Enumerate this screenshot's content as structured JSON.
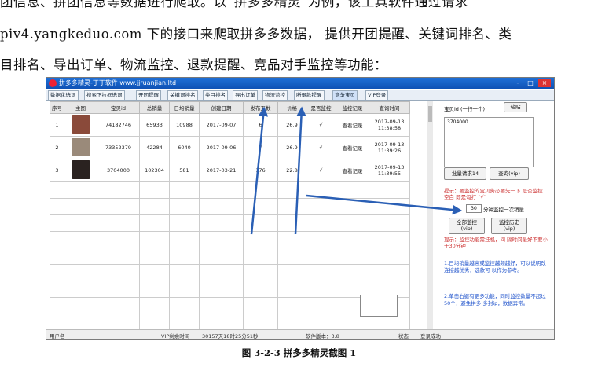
{
  "paragraph": {
    "line1": "团信息、拼团信息等数据进行爬取。以“拼多多精灵”为例，该工具软件通过请求",
    "line2": "piv4.yangkeduo.com 下的接口来爬取拼多多数据， 提供开团提醒、关键词排名、类",
    "line3": "目排名、导出订单、物流监控、退款提醒、竞品对手监控等功能："
  },
  "app": {
    "title": "拼多多精灵-丁丁软件 www.jjruanjian.ltd",
    "window_buttons": [
      "-",
      "□",
      "×"
    ],
    "tabs": [
      "数据化选词",
      "搜索下拉框选词",
      "开团提醒",
      "关键词排名",
      "类目排名",
      "导出订单",
      "物流监控",
      "断退款提醒",
      "竞争宝贝",
      "VIP登录"
    ],
    "columns": [
      "序号",
      "主图",
      "宝贝id",
      "总销量",
      "日均销量",
      "创建日期",
      "发布天数",
      "价格",
      "是否监控",
      "监控记录",
      "查询时间"
    ],
    "rows": [
      {
        "index": "1",
        "id": "74182746",
        "total": "65933",
        "daily": "10988",
        "created": "2017-09-07",
        "days": "6",
        "price": "26.9",
        "monitored": "√",
        "record": "查看记录",
        "time_date": "2017-09-13",
        "time_clock": "11:38:58",
        "thumb_color": "#8a4a3a"
      },
      {
        "index": "2",
        "id": "73352379",
        "total": "42284",
        "daily": "6040",
        "created": "2017-09-06",
        "days": "7",
        "price": "26.9",
        "monitored": "√",
        "record": "查看记录",
        "time_date": "2017-09-13",
        "time_clock": "11:39:26",
        "thumb_color": "#9a8a7a"
      },
      {
        "index": "3",
        "id": "3704000",
        "total": "102304",
        "daily": "581",
        "created": "2017-03-21",
        "days": "176",
        "price": "22.8",
        "monitored": "√",
        "record": "查看记录",
        "time_date": "2017-09-13",
        "time_clock": "11:39:55",
        "thumb_color": "#2a2220"
      }
    ],
    "right_panel": {
      "header": "宝贝id (一行一个)",
      "paste_button": "粘贴",
      "id_list": "3704000",
      "import_button": "批量请求14",
      "query_button": "查询(vip)",
      "hint": "提示：要监控的宝贝务必要先一下 是否监控 空白 即是勾打 “√”",
      "interval_value": "30",
      "interval_label": "分钟监控一次销量",
      "start_button": "全部监控",
      "start_button_sub": "(vip)",
      "history_button": "监控历史",
      "history_button_sub": "(vip)",
      "hint2": "提示：监控功能需挂机，间 隔时间最好不要小于30分钟",
      "note1": "1.日均销量越高或监控越频越好，可以说明改连接越优秀，选款可 以作为参考。",
      "note2": "2.单击右键有更多功能，同时监控数量不超过50个，避免拼多 多封ip，数据异常。"
    },
    "status": {
      "user_label": "用户名",
      "vip_label": "VIP剩余时间",
      "vip_remaining": "30157天18时25分51秒",
      "version_label": "软件版本：3.8",
      "state_label": "状态",
      "state_value": "登录成功"
    }
  },
  "caption": "图 3-2-3  拼多多精灵截图 1"
}
